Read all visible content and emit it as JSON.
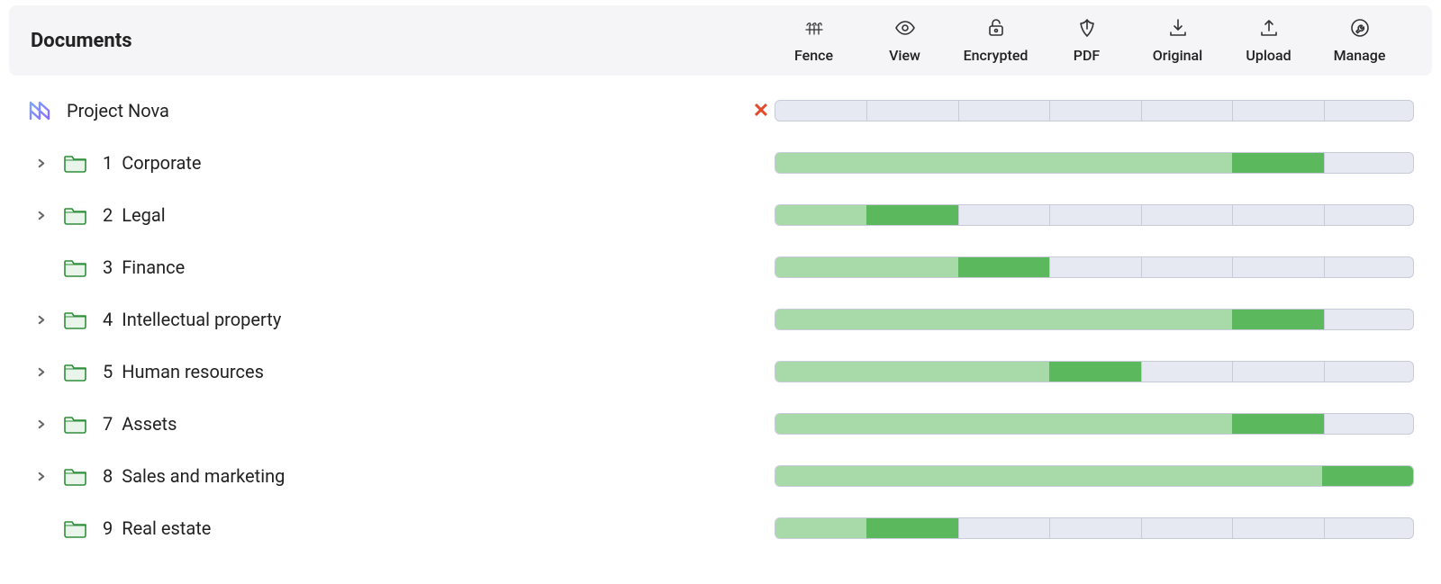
{
  "header": {
    "title": "Documents",
    "columns": [
      {
        "key": "fence",
        "label": "Fence",
        "icon": "fence-icon"
      },
      {
        "key": "view",
        "label": "View",
        "icon": "eye-icon"
      },
      {
        "key": "encrypted",
        "label": "Encrypted",
        "icon": "lock-icon"
      },
      {
        "key": "pdf",
        "label": "PDF",
        "icon": "pdf-icon"
      },
      {
        "key": "original",
        "label": "Original",
        "icon": "download-tray-icon"
      },
      {
        "key": "upload",
        "label": "Upload",
        "icon": "upload-tray-icon"
      },
      {
        "key": "manage",
        "label": "Manage",
        "icon": "wrench-icon"
      }
    ]
  },
  "chart_data": {
    "type": "bar",
    "note": "Permission bars. Each row has a seven-cell track; light green covers cells [0, a), dark green covers cells [a, b). Remaining cells are blank.",
    "column_count": 7,
    "columns": [
      "Fence",
      "View",
      "Encrypted",
      "PDF",
      "Original",
      "Upload",
      "Manage"
    ],
    "rows": [
      {
        "name": "Project Nova",
        "light": 0,
        "dark": 0
      },
      {
        "name": "1 Corporate",
        "light": 5,
        "dark": 6
      },
      {
        "name": "2 Legal",
        "light": 1,
        "dark": 2
      },
      {
        "name": "3 Finance",
        "light": 2,
        "dark": 3
      },
      {
        "name": "4 Intellectual property",
        "light": 5,
        "dark": 6
      },
      {
        "name": "5 Human resources",
        "light": 3,
        "dark": 4
      },
      {
        "name": "7 Assets",
        "light": 5,
        "dark": 6
      },
      {
        "name": "8 Sales and marketing",
        "light": 6,
        "dark": 7
      },
      {
        "name": "9 Real estate",
        "light": 1,
        "dark": 2
      }
    ]
  },
  "tree": [
    {
      "id": "root",
      "num": "",
      "name": "Project Nova",
      "expandable": false,
      "icon": "logo",
      "status": "denied",
      "bar": {
        "light": 0,
        "dark": 0
      }
    },
    {
      "id": "1",
      "num": "1",
      "name": "Corporate",
      "expandable": true,
      "icon": "folder",
      "status": "",
      "bar": {
        "light": 5,
        "dark": 6
      }
    },
    {
      "id": "2",
      "num": "2",
      "name": "Legal",
      "expandable": true,
      "icon": "folder",
      "status": "",
      "bar": {
        "light": 1,
        "dark": 2
      }
    },
    {
      "id": "3",
      "num": "3",
      "name": "Finance",
      "expandable": false,
      "icon": "folder",
      "status": "",
      "bar": {
        "light": 2,
        "dark": 3
      }
    },
    {
      "id": "4",
      "num": "4",
      "name": "Intellectual property",
      "expandable": true,
      "icon": "folder",
      "status": "",
      "bar": {
        "light": 5,
        "dark": 6
      }
    },
    {
      "id": "5",
      "num": "5",
      "name": "Human resources",
      "expandable": true,
      "icon": "folder",
      "status": "",
      "bar": {
        "light": 3,
        "dark": 4
      }
    },
    {
      "id": "7",
      "num": "7",
      "name": "Assets",
      "expandable": true,
      "icon": "folder",
      "status": "",
      "bar": {
        "light": 5,
        "dark": 6
      }
    },
    {
      "id": "8",
      "num": "8",
      "name": "Sales and marketing",
      "expandable": true,
      "icon": "folder",
      "status": "",
      "bar": {
        "light": 6,
        "dark": 7
      }
    },
    {
      "id": "9",
      "num": "9",
      "name": "Real estate",
      "expandable": false,
      "icon": "folder",
      "status": "",
      "bar": {
        "light": 1,
        "dark": 2
      }
    }
  ],
  "colors": {
    "light_green": "#a8d9a8",
    "dark_green": "#5cb85c"
  },
  "status_glyphs": {
    "denied": "✕"
  }
}
